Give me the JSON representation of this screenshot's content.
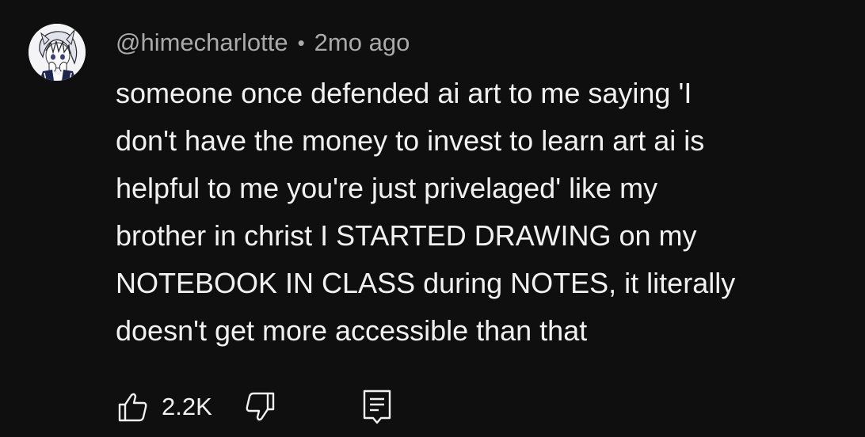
{
  "comment": {
    "handle": "@himecharlotte",
    "separator": "•",
    "time": "2mo ago",
    "lines": [
      "someone once defended ai art to me saying 'I",
      "don't have the money to invest to learn art ai is",
      "helpful to me you're just privelaged' like my",
      "brother in christ I STARTED DRAWING on my",
      "NOTEBOOK IN CLASS during NOTES, it literally",
      "doesn't get more accessible than that"
    ],
    "like_count": "2.2K"
  },
  "icons": {
    "like": "thumbs-up-icon",
    "dislike": "thumbs-down-icon",
    "reply": "reply-comment-icon"
  },
  "colors": {
    "background": "#0f0f0f",
    "text": "#f1f1f1",
    "meta": "#aaaaaa"
  }
}
